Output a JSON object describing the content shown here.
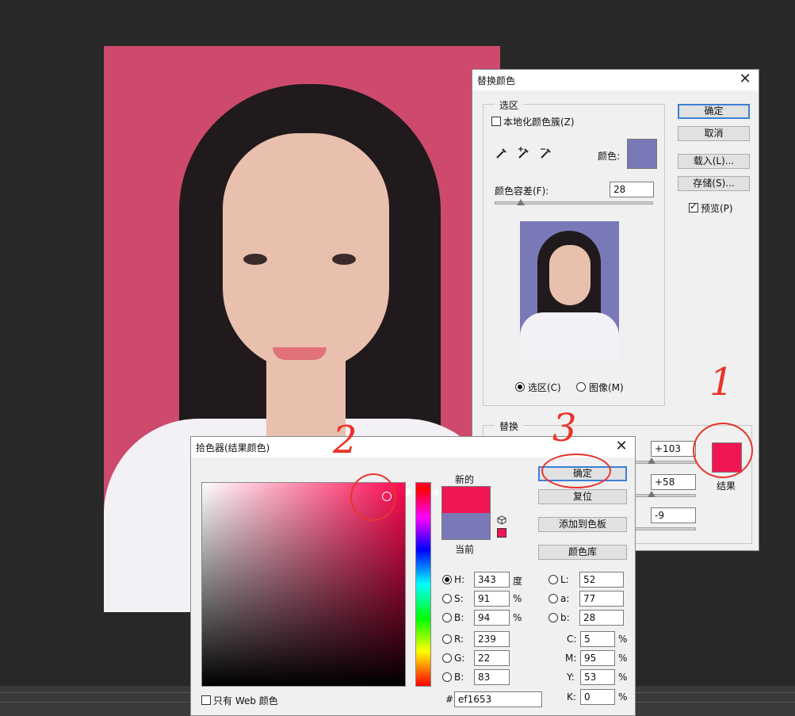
{
  "replace_dialog": {
    "title": "替换颜色",
    "selection_group": "选区",
    "localized_clusters": "本地化颜色簇(Z)",
    "color_label": "颜色:",
    "selection_color": "#7a79b8",
    "fuzziness_label": "颜色容差(F):",
    "fuzziness_value": "28",
    "fuzziness_fraction": 0.14,
    "radio_selection": "选区(C)",
    "radio_image": "图像(M)",
    "buttons": {
      "ok": "确定",
      "cancel": "取消",
      "load": "载入(L)...",
      "save": "存储(S)..."
    },
    "preview_label": "预览(P)",
    "replacement_group": "替换",
    "hue_value": "+103",
    "saturation_value": "+58",
    "lightness_value": "-9",
    "result_label": "结果",
    "result_color": "#ef1653"
  },
  "color_picker": {
    "title": "拾色器(结果颜色)",
    "new_label": "新的",
    "current_label": "当前",
    "new_color": "#ef1653",
    "current_color": "#7a79b8",
    "buttons": {
      "ok": "确定",
      "reset": "复位",
      "add_swatch": "添加到色板",
      "libraries": "颜色库"
    },
    "hsb": {
      "h_label": "H:",
      "h_value": "343",
      "h_unit": "度",
      "s_label": "S:",
      "s_value": "91",
      "s_unit": "%",
      "b_label": "B:",
      "b_value": "94",
      "b_unit": "%"
    },
    "rgb": {
      "r_label": "R:",
      "r_value": "239",
      "g_label": "G:",
      "g_value": "22",
      "b_label": "B:",
      "b_value": "83"
    },
    "lab": {
      "l_label": "L:",
      "l_value": "52",
      "a_label": "a:",
      "a_value": "77",
      "b_label": "b:",
      "b_value": "28"
    },
    "cmyk": {
      "c_label": "C:",
      "c_value": "5",
      "m_label": "M:",
      "m_value": "95",
      "y_label": "Y:",
      "y_value": "53",
      "k_label": "K:",
      "k_value": "0",
      "unit": "%"
    },
    "hex_label": "#",
    "hex_value": "ef1653",
    "web_only": "只有 Web 颜色"
  },
  "annotations": {
    "n1": "1",
    "n2": "2",
    "n3": "3"
  },
  "icons": [
    "close-icon",
    "eyedropper-icon",
    "eyedropper-plus-icon",
    "eyedropper-minus-icon",
    "gamut-cube-icon"
  ]
}
